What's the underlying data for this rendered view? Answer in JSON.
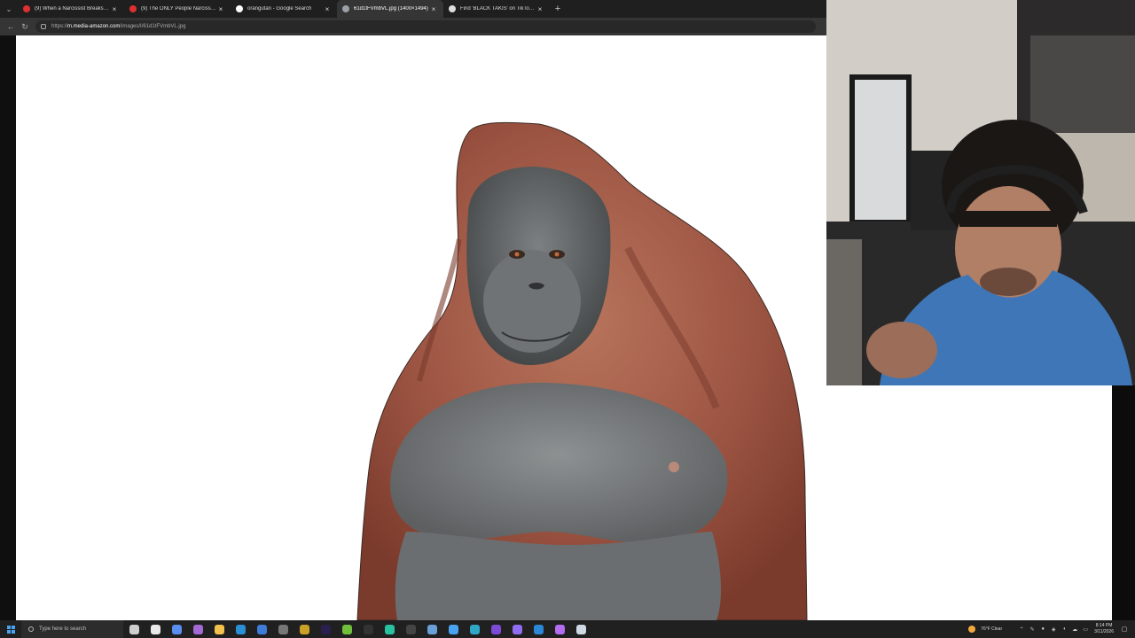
{
  "browser": {
    "tabs": [
      {
        "label": "(9) When a Narcissist Breaks the",
        "favicon": "youtube-icon",
        "color": "#e02f2f",
        "active": false
      },
      {
        "label": "(9) The ONLY People Narcissists",
        "favicon": "youtube-icon",
        "color": "#e02f2f",
        "active": false
      },
      {
        "label": "orangutan - Google Search",
        "favicon": "google-icon",
        "color": "#ffffff",
        "active": false
      },
      {
        "label": "61d1tFVmbVL.jpg (1400×1494)",
        "favicon": "globe-icon",
        "color": "#9aa0a6",
        "active": true
      },
      {
        "label": "Find 'BLACK TAKIS' on TikTok | Ti",
        "favicon": "tiktok-icon",
        "color": "#dddddd",
        "active": false
      }
    ],
    "close_glyph": "×",
    "new_tab_glyph": "+",
    "tab_menu_glyph": "⌄",
    "back_glyph": "←",
    "reload_glyph": "↻",
    "url_prefix": "https://",
    "url_host": "m.media-amazon.com",
    "url_path": "/images/I/61d1tFVmbVL.jpg"
  },
  "page": {
    "content": "orangutan photo",
    "background": "#ffffff"
  },
  "taskbar": {
    "search_placeholder": "Type here to search",
    "apps": [
      {
        "name": "task-view-icon",
        "color": "#cfcfcf"
      },
      {
        "name": "app-icon",
        "color": "#e9e9e9"
      },
      {
        "name": "copilot-icon",
        "color": "#5a8df0"
      },
      {
        "name": "obs-icon",
        "color": "#a36ad6"
      },
      {
        "name": "file-explorer-icon",
        "color": "#f2c14e"
      },
      {
        "name": "edge-icon",
        "color": "#2b8fd6"
      },
      {
        "name": "app-icon",
        "color": "#3f7bd9"
      },
      {
        "name": "app-icon",
        "color": "#777777"
      },
      {
        "name": "app-icon",
        "color": "#c9a227"
      },
      {
        "name": "premiere-icon",
        "color": "#2a1f4f"
      },
      {
        "name": "nvidia-icon",
        "color": "#6fbf3a"
      },
      {
        "name": "app-icon",
        "color": "#333333"
      },
      {
        "name": "app-icon",
        "color": "#29c2a0"
      },
      {
        "name": "app-icon",
        "color": "#444444"
      },
      {
        "name": "app-icon",
        "color": "#6aa0d8"
      },
      {
        "name": "app-icon",
        "color": "#4aa3f0"
      },
      {
        "name": "app-icon",
        "color": "#2fa8c7"
      },
      {
        "name": "app-icon",
        "color": "#7b4bd6"
      },
      {
        "name": "app-icon",
        "color": "#8f6cf0"
      },
      {
        "name": "app-icon",
        "color": "#2b88d8"
      },
      {
        "name": "app-icon",
        "color": "#b46cf0"
      },
      {
        "name": "steam-icon",
        "color": "#cfd8e3"
      }
    ],
    "weather": "76°F  Clear",
    "time": "8:14 PM",
    "date": "3/11/2026"
  }
}
